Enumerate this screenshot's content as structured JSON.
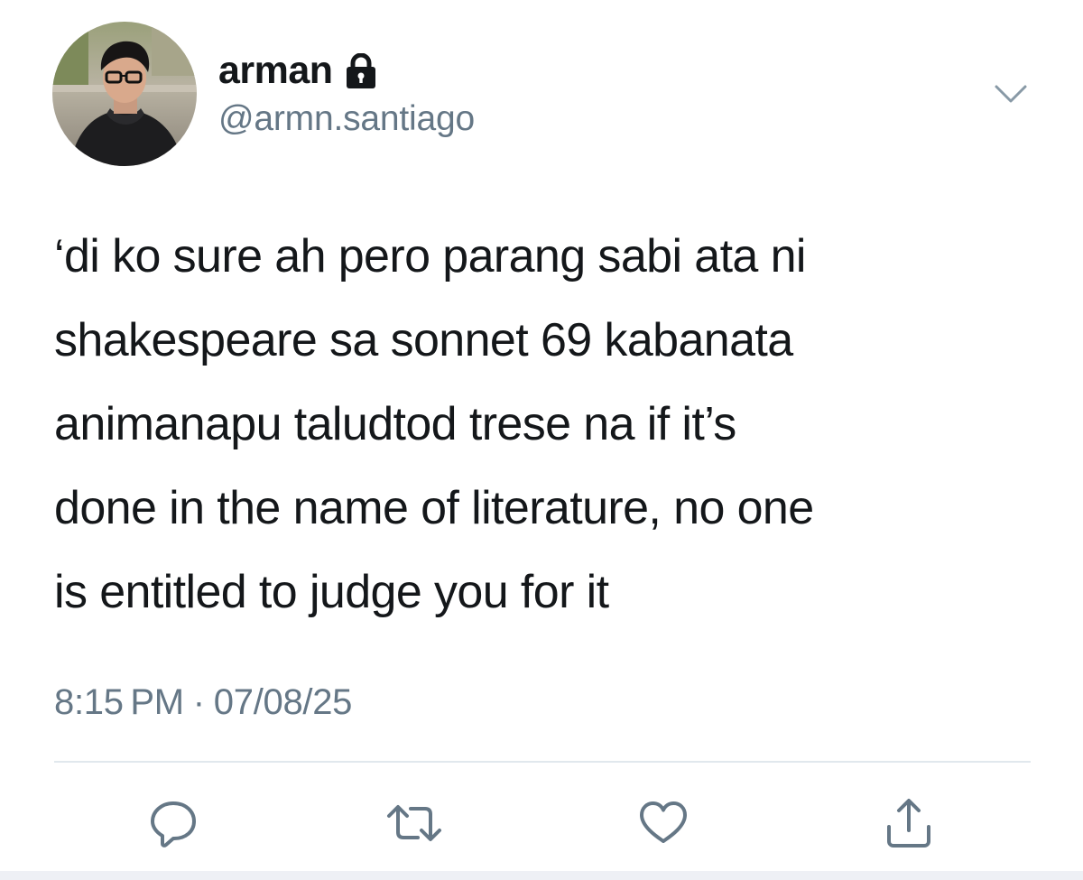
{
  "user": {
    "display_name": "arman",
    "handle": "@armn.santiago",
    "protected_icon": "lock-icon",
    "avatar": "profile-photo"
  },
  "tweet": {
    "lines": [
      "‘di ko sure ah pero parang sabi ata ni",
      "shakespeare sa sonnet 69 kabanata",
      "animanapu taludtod trese na if it’s",
      "done in the name of literature, no one",
      "is entitled to judge you for it"
    ],
    "time": "8:15 PM",
    "separator": "·",
    "date": "07/08/25"
  },
  "actions": [
    {
      "name": "reply",
      "icon": "reply-icon"
    },
    {
      "name": "retweet",
      "icon": "retweet-icon"
    },
    {
      "name": "like",
      "icon": "heart-icon"
    },
    {
      "name": "share",
      "icon": "share-icon"
    }
  ],
  "menu_icon": "chevron-down-icon",
  "colors": {
    "text": "#14171a",
    "secondary": "#657786",
    "divider": "#e1e8ed"
  }
}
